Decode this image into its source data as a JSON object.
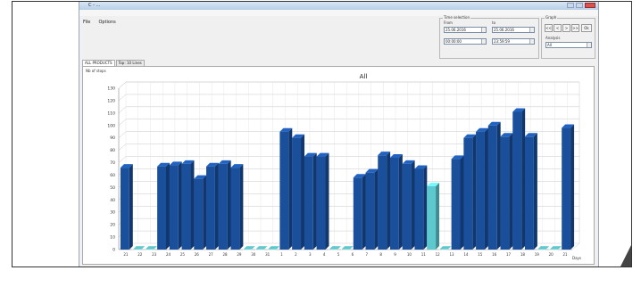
{
  "window": {
    "title": "C - ..."
  },
  "menu": {
    "items": [
      "File",
      "Options"
    ]
  },
  "time_selection": {
    "caption": "Time selection",
    "from_label": "From",
    "to_label": "to",
    "from_date": "25.06.2016",
    "from_time": "00:00:00",
    "to_date": "25.06.2016",
    "to_time": "23:59:59"
  },
  "zoom": {
    "caption": "Graph",
    "buttons": [
      "<<",
      "<",
      ">",
      ">>",
      "Ok"
    ],
    "select_label": "Analysis",
    "select_value": "All"
  },
  "tabs": [
    {
      "label": "ALL PRODUCTS"
    },
    {
      "label": "Top: 10 Lines"
    }
  ],
  "chart_area": {
    "caption": "Nb of stops"
  },
  "chart_data": {
    "type": "bar",
    "title": "All",
    "ylabel": "",
    "xlabel": "Days",
    "ylim": [
      0,
      130
    ],
    "yticks": [
      0,
      10,
      20,
      30,
      40,
      50,
      60,
      70,
      80,
      90,
      100,
      110,
      120,
      130
    ],
    "categories": [
      "21",
      "22",
      "23",
      "24",
      "25",
      "26",
      "27",
      "28",
      "29",
      "30",
      "31",
      "1",
      "2",
      "3",
      "4",
      "5",
      "6",
      "7",
      "8",
      "9",
      "10",
      "11",
      "12",
      "13",
      "14",
      "15",
      "16",
      "17",
      "18",
      "19",
      "20",
      "21"
    ],
    "series": [
      {
        "values": [
          66,
          0,
          0,
          67,
          68,
          69,
          57,
          67,
          69,
          66,
          0,
          0,
          0,
          95,
          90,
          75,
          75,
          0,
          0,
          58,
          62,
          76,
          74,
          69,
          65,
          51,
          0,
          73,
          90,
          95,
          100,
          91,
          111,
          91,
          0,
          0,
          98
        ],
        "colors": [
          "#1a4f9c",
          "#5ec8cf",
          "#5ec8cf",
          "#1a4f9c",
          "#1a4f9c",
          "#1a4f9c",
          "#1a4f9c",
          "#1a4f9c",
          "#1a4f9c",
          "#1a4f9c",
          "#5ec8cf",
          "#5ec8cf",
          "#5ec8cf",
          "#1a4f9c",
          "#1a4f9c",
          "#1a4f9c",
          "#1a4f9c",
          "#5ec8cf",
          "#5ec8cf",
          "#1a4f9c",
          "#1a4f9c",
          "#1a4f9c",
          "#1a4f9c",
          "#1a4f9c",
          "#1a4f9c",
          "#5ec8cf",
          "#5ec8cf",
          "#1a4f9c",
          "#1a4f9c",
          "#1a4f9c",
          "#1a4f9c",
          "#1a4f9c",
          "#1a4f9c",
          "#1a4f9c",
          "#5ec8cf",
          "#5ec8cf",
          "#1a4f9c"
        ]
      }
    ],
    "grid": true,
    "colors": {
      "primary": "#1a4f9c",
      "secondary": "#5ec8cf"
    }
  }
}
